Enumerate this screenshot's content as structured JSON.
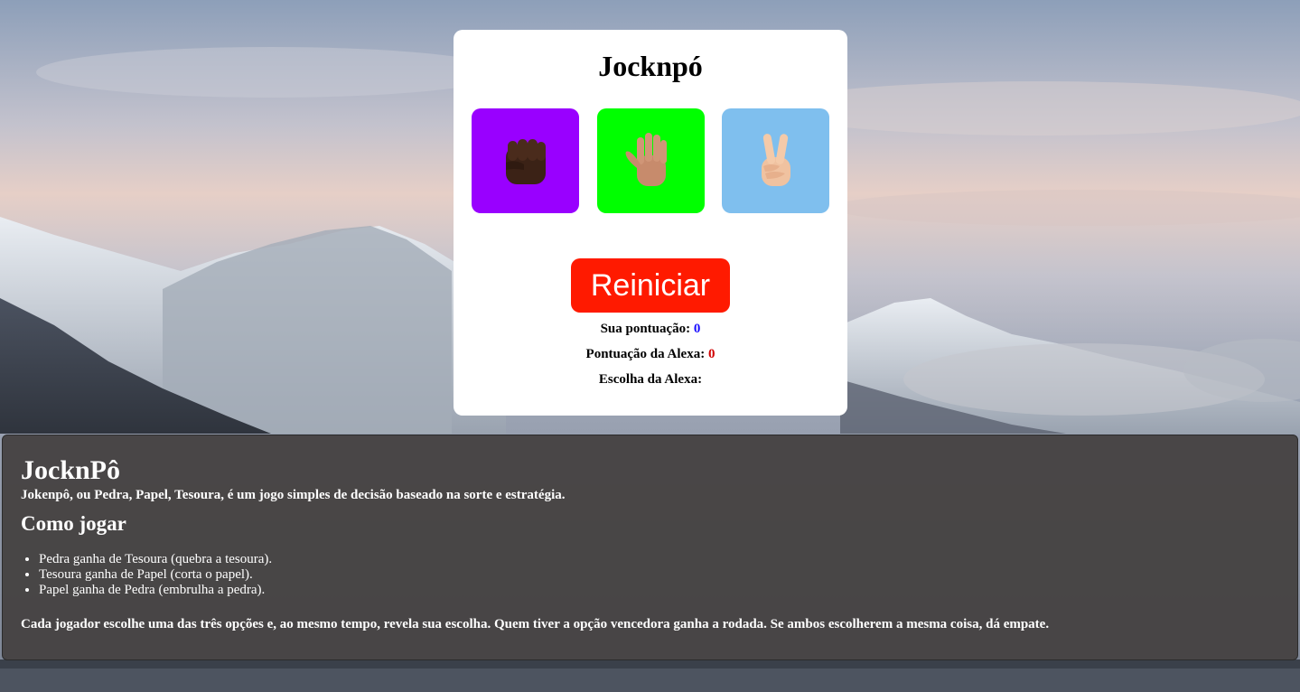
{
  "game": {
    "title": "Jocknpó",
    "choices": [
      {
        "id": "rock",
        "icon": "fist-icon",
        "color": "#9900ff"
      },
      {
        "id": "paper",
        "icon": "raised-hand-icon",
        "color": "#00ff00"
      },
      {
        "id": "scissors",
        "icon": "victory-hand-icon",
        "color": "#7fbfee"
      }
    ],
    "restart_label": "Reiniciar",
    "restart_color": "#ff1a00",
    "user_score_label": "Sua pontuação:",
    "user_score_value": "0",
    "alexa_score_label": "Pontuação da Alexa:",
    "alexa_score_value": "0",
    "alexa_choice_label": "Escolha da Alexa:",
    "alexa_choice_value": ""
  },
  "info": {
    "title": "JocknPô",
    "intro": "Jokenpô, ou Pedra, Papel, Tesoura, é um jogo simples de decisão baseado na sorte e estratégia.",
    "subtitle": "Como jogar",
    "rules": [
      "Pedra ganha de Tesoura (quebra a tesoura).",
      "Tesoura ganha de Papel (corta o papel).",
      "Papel ganha de Pedra (embrulha a pedra)."
    ],
    "footer": "Cada jogador escolhe uma das três opções e, ao mesmo tempo, revela sua escolha. Quem tiver a opção vencedora ganha a rodada. Se ambos escolherem a mesma coisa, dá empate."
  }
}
